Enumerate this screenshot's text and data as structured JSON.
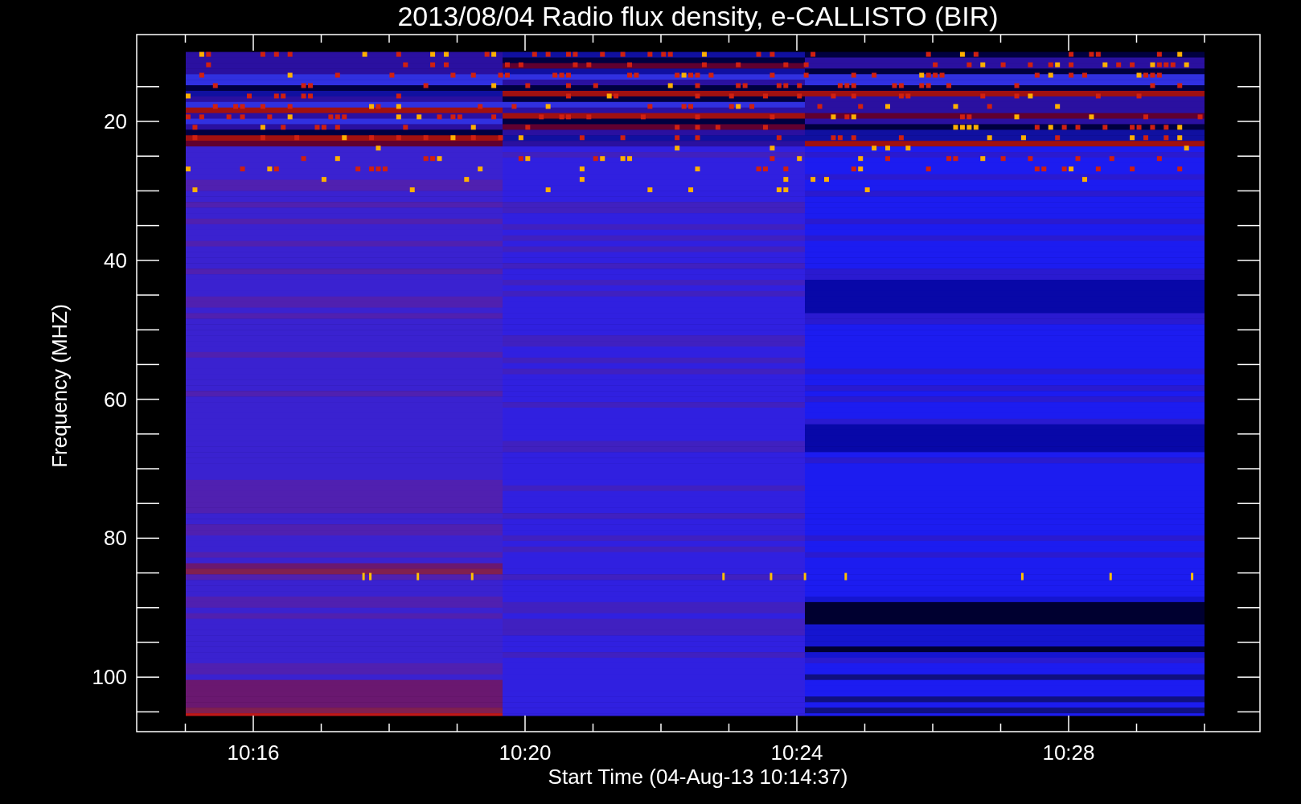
{
  "plot": {
    "title": "2013/08/04  Radio flux density, e-CALLISTO (BIR)",
    "ylabel": "Frequency (MHZ)",
    "xlabel": "Start Time (04-Aug-13 10:14:37)",
    "yticks": [
      "20",
      "40",
      "60",
      "80",
      "100"
    ],
    "xticks": [
      "10:16",
      "10:20",
      "10:24",
      "10:28"
    ]
  }
}
